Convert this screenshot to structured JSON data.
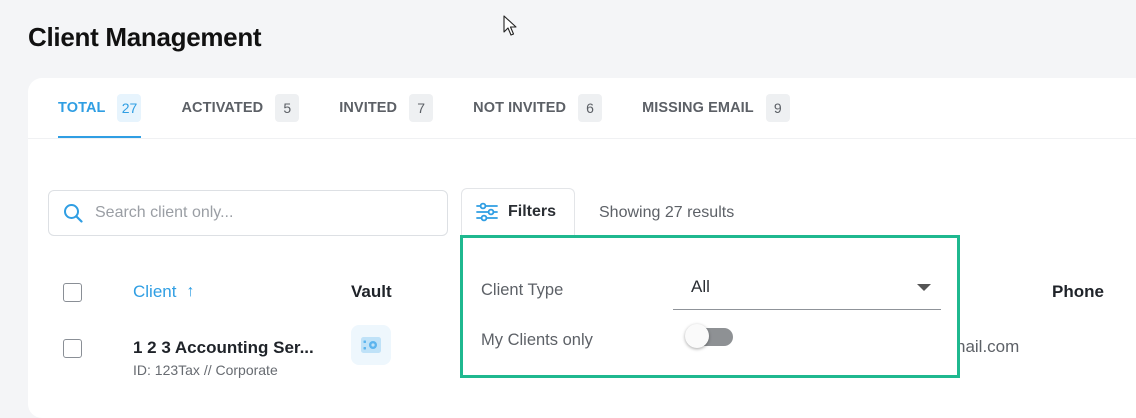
{
  "page": {
    "title": "Client Management"
  },
  "tabs": [
    {
      "label": "TOTAL",
      "count": "27",
      "active": true
    },
    {
      "label": "ACTIVATED",
      "count": "5",
      "active": false
    },
    {
      "label": "INVITED",
      "count": "7",
      "active": false
    },
    {
      "label": "NOT INVITED",
      "count": "6",
      "active": false
    },
    {
      "label": "MISSING EMAIL",
      "count": "9",
      "active": false
    }
  ],
  "toolbar": {
    "search_placeholder": "Search client only...",
    "filters_label": "Filters",
    "results_text": "Showing 27 results"
  },
  "table": {
    "columns": {
      "client": "Client",
      "client_sort_icon": "↑",
      "vault": "Vault",
      "phone": "Phone"
    },
    "rows": [
      {
        "name": "1 2 3 Accounting Ser...",
        "id_line": "ID: 123Tax // Corporate",
        "email_fragment": "nail.com"
      }
    ]
  },
  "filter_panel": {
    "client_type_label": "Client Type",
    "client_type_value": "All",
    "my_clients_label": "My Clients only",
    "my_clients_on": false
  },
  "colors": {
    "accent": "#2f9ee3",
    "highlight_border": "#1fb88f"
  },
  "icons": [
    "search-icon",
    "filter-sliders-icon",
    "sort-up-icon",
    "vault-icon",
    "caret-down-icon",
    "mouse-cursor"
  ]
}
